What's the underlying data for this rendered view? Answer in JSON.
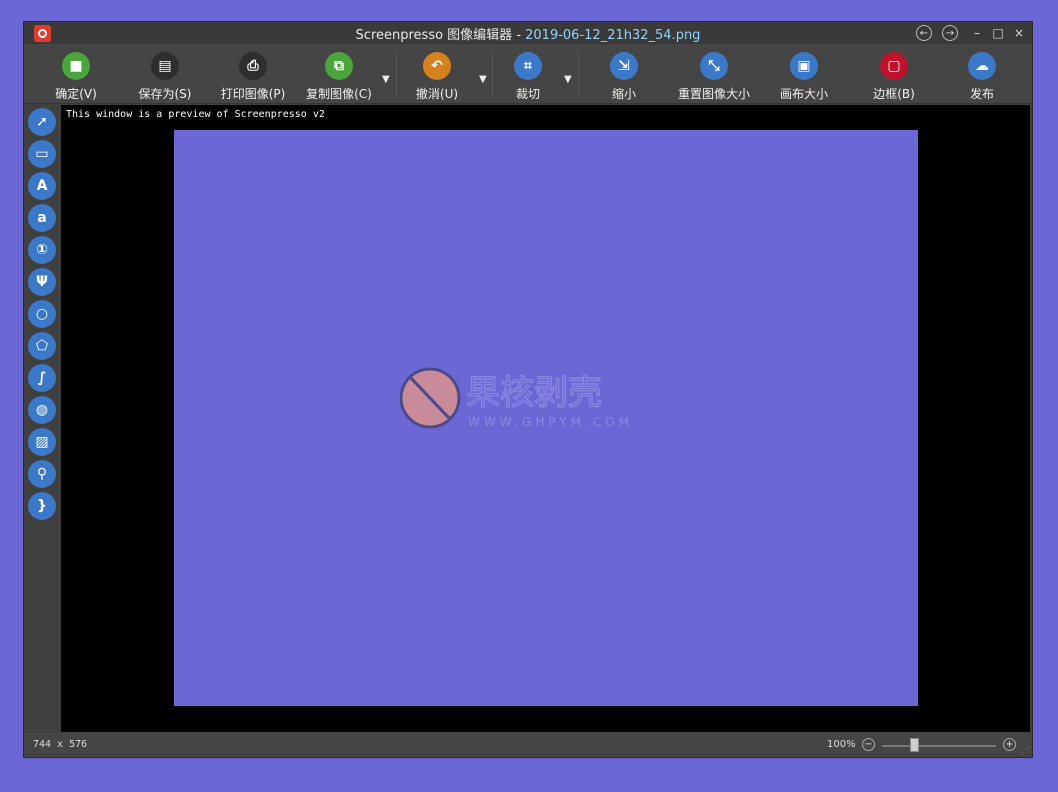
{
  "window": {
    "app_name": "Screenpresso 图像编辑器 - ",
    "file_name": "2019-06-12_21h32_54.png"
  },
  "titlebar_controls": {
    "back": "←",
    "forward": "→",
    "minimize": "–",
    "maximize": "□",
    "close": "×"
  },
  "toolbar": {
    "tools": [
      {
        "label": "确定(V)",
        "glyph": "■",
        "color": "#4ca43c"
      },
      {
        "label": "保存为(S)",
        "glyph": "▤",
        "color": "#2e2e2e"
      },
      {
        "label": "打印图像(P)",
        "glyph": "⎙",
        "color": "#2e2e2e"
      },
      {
        "label": "复制图像(C)",
        "glyph": "⧉",
        "color": "#4ca43c"
      },
      {
        "label": "撤消(U)",
        "glyph": "↶",
        "color": "#d4811e"
      },
      {
        "label": "裁切",
        "glyph": "⌗",
        "color": "#3c78c8"
      },
      {
        "label": "缩小",
        "glyph": "⇲",
        "color": "#3c78c8"
      },
      {
        "label": "重置图像大小",
        "glyph": "⤡",
        "color": "#3c78c8"
      },
      {
        "label": "画布大小",
        "glyph": "▣",
        "color": "#3c78c8"
      },
      {
        "label": "边框(B)",
        "glyph": "▢",
        "color": "#c0122a"
      },
      {
        "label": "发布",
        "glyph": "☁",
        "color": "#3c78c8"
      }
    ],
    "dropdown_glyph": "▼"
  },
  "sidebar": {
    "tools": [
      {
        "name": "arrow-icon",
        "glyph": "➚"
      },
      {
        "name": "rectangle-icon",
        "glyph": "▭"
      },
      {
        "name": "text-icon",
        "glyph": "A"
      },
      {
        "name": "label-icon",
        "glyph": "a"
      },
      {
        "name": "numbering-icon",
        "glyph": "①"
      },
      {
        "name": "highlighter-icon",
        "glyph": "Ψ"
      },
      {
        "name": "ellipse-icon",
        "glyph": "○"
      },
      {
        "name": "polygon-icon",
        "glyph": "⬠"
      },
      {
        "name": "freehand-icon",
        "glyph": "∫"
      },
      {
        "name": "blur-icon",
        "glyph": "◍"
      },
      {
        "name": "image-icon",
        "glyph": "▨"
      },
      {
        "name": "magnifier-icon",
        "glyph": "⚲"
      },
      {
        "name": "brace-icon",
        "glyph": "}"
      }
    ]
  },
  "canvas": {
    "preview_note": "This window is a preview of Screenpresso v2",
    "watermark_chars": "果核剥壳",
    "watermark_url": "WWW.GHPYM.COM"
  },
  "status": {
    "dimensions": "744 x 576",
    "zoom": "100%",
    "zoom_out": "−",
    "zoom_in": "+",
    "grip": "⋰"
  },
  "colors": {
    "accent": "#3c78c8",
    "file_name": "#8fd3ff",
    "background": "#6b68d6"
  }
}
